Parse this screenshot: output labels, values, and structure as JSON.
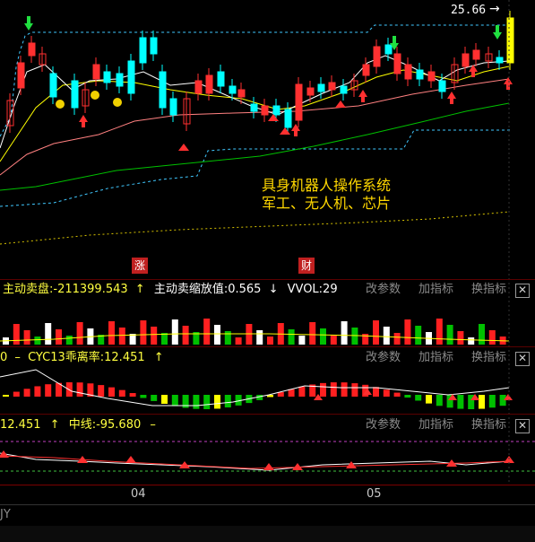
{
  "main_chart": {
    "price_label": "25.66",
    "annotation_line1": "具身机器人操作系统",
    "annotation_line2": "军工、无人机、芯片",
    "badge_zhang": "涨",
    "badge_cai": "财"
  },
  "panel1": {
    "indicator_left": "主动卖盘:-211399.543",
    "indicator_arrow_left": "↑",
    "indicator_mid": "主动卖缩放值:0.565",
    "indicator_arrow_mid": "↓",
    "indicator_right": "VVOL:29",
    "btn_params": "改参数",
    "btn_add": "加指标",
    "btn_switch": "换指标"
  },
  "panel2": {
    "indicator_prefix": "0",
    "indicator_text": "CYC13乖离率:12.451",
    "indicator_arrow": "↑",
    "btn_params": "改参数",
    "btn_add": "加指标",
    "btn_switch": "换指标"
  },
  "panel3": {
    "indicator_text_a": "12.451",
    "indicator_arrow_a": "↑",
    "indicator_text_b": "中线:-95.680",
    "indicator_arrow_b": "–",
    "btn_params": "改参数",
    "btn_add": "加指标",
    "btn_switch": "换指标"
  },
  "x_axis": {
    "label_04": "04",
    "label_05": "05"
  },
  "footer": {
    "label": "JY"
  },
  "colors": {
    "up": "#ff3030",
    "down": "#00ffff",
    "ma_white": "#ffffff",
    "ma_yellow": "#ffff00",
    "ma_pink": "#ff8080",
    "ma_green": "#00c000",
    "annotation": "#ffd700",
    "indicator_title": "#ffff40"
  }
}
